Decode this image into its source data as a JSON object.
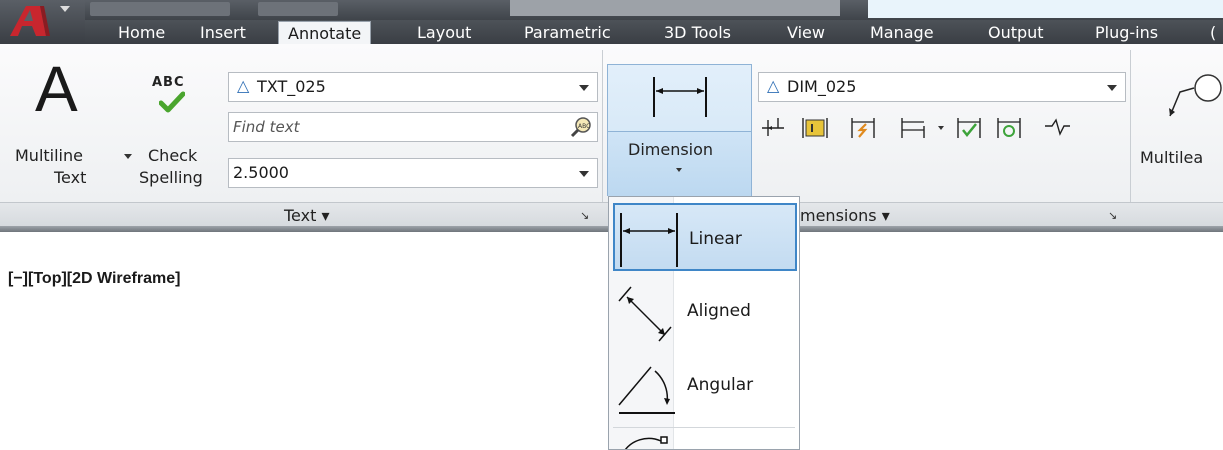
{
  "ribbon_tabs": [
    "Home",
    "Insert",
    "Annotate",
    "Layout",
    "Parametric",
    "3D Tools",
    "View",
    "Manage",
    "Output",
    "Plug-ins",
    "("
  ],
  "active_tab": "Annotate",
  "text_panel": {
    "multiline_line1": "Multiline",
    "multiline_line2": "Text",
    "check_icon_text": "ABC",
    "check_line1": "Check",
    "check_line2": "Spelling",
    "text_style": "TXT_025",
    "find_placeholder": "Find text",
    "text_height": "2.5000",
    "panel_title": "Text ▾"
  },
  "dimensions_panel": {
    "dim_style": "DIM_025",
    "dimension_label": "Dimension",
    "panel_title": "mensions ▾"
  },
  "leaders_panel": {
    "multileader_label": "Multilea"
  },
  "dimension_menu": {
    "items": [
      {
        "label": "Linear",
        "icon": "linear-dimension-icon",
        "selected": true
      },
      {
        "label": "Aligned",
        "icon": "aligned-dimension-icon",
        "selected": false
      },
      {
        "label": "Angular",
        "icon": "angular-dimension-icon",
        "selected": false
      }
    ]
  },
  "viewport": {
    "label": "[−][Top][2D Wireframe]"
  },
  "colors": {
    "tab_bar": "#3f444a",
    "selection": "#3f86c7",
    "selection_fill": "#cfe4f6",
    "ribbon_bg": "#f3f5f7"
  }
}
